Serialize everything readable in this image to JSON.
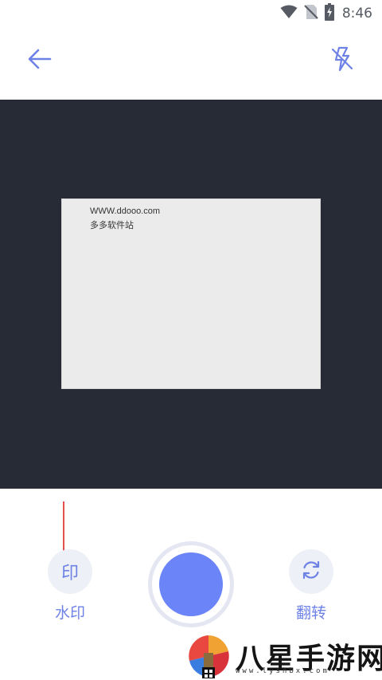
{
  "status_bar": {
    "time": "8:46",
    "icons": [
      "wifi-icon",
      "no-sim-icon",
      "battery-charging-icon"
    ]
  },
  "top_bar": {
    "back_icon": "arrow-left-icon",
    "flash_icon": "flash-off-icon"
  },
  "preview": {
    "document_text": {
      "line1": "WWW.ddooo.com",
      "line2": "多多软件站"
    }
  },
  "controls": {
    "watermark": {
      "glyph": "印",
      "label": "水印"
    },
    "flip": {
      "icon": "refresh-icon",
      "label": "翻转"
    },
    "shutter": {
      "icon": "shutter-button"
    }
  },
  "watermark_overlay": {
    "text": [
      "八",
      "星",
      "手",
      "游",
      "网"
    ],
    "url": "www.lyshbx.com"
  },
  "colors": {
    "accent": "#6e82e6",
    "shutter": "#6b84f8",
    "preview_bg": "#262b35",
    "arrow": "#d9231f"
  }
}
